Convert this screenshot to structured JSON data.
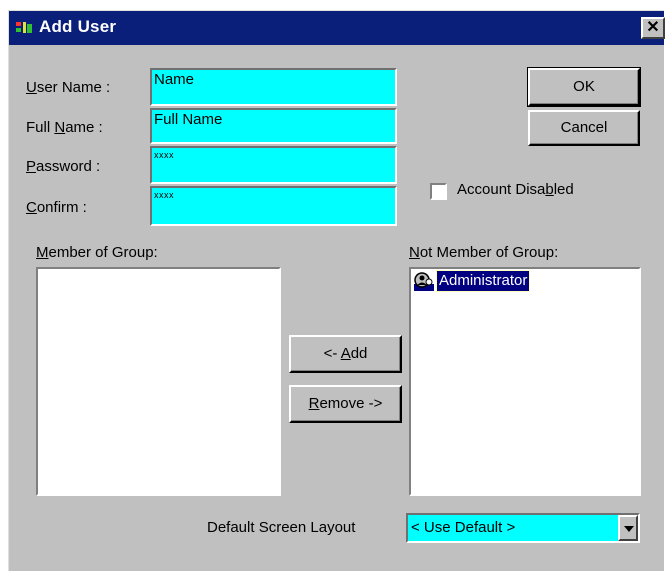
{
  "window": {
    "title": "Add User",
    "close_glyph": "✕"
  },
  "form": {
    "user_name": {
      "label_pre": "",
      "label_key": "U",
      "label_post": "ser Name :",
      "value": "Name"
    },
    "full_name": {
      "label_pre": "Full ",
      "label_key": "N",
      "label_post": "ame :",
      "value": "Full Name"
    },
    "password": {
      "label_pre": "",
      "label_key": "P",
      "label_post": "assword :",
      "value": "xxxx"
    },
    "confirm": {
      "label_pre": "",
      "label_key": "C",
      "label_post": "onfirm :",
      "value": "xxxx"
    }
  },
  "buttons": {
    "ok": "OK",
    "cancel": "Cancel",
    "add_pre": "<- ",
    "add_key": "A",
    "add_post": "dd",
    "remove_pre": "",
    "remove_key": "R",
    "remove_post": "emove ->"
  },
  "account_disabled": {
    "label_pre": "Account Disa",
    "label_key": "b",
    "label_post": "led",
    "checked": false
  },
  "member_of_group": {
    "label_pre": "",
    "label_key": "M",
    "label_post": "ember of Group:",
    "items": []
  },
  "not_member_of_group": {
    "label_pre": "",
    "label_key": "N",
    "label_post": "ot Member of Group:",
    "items": [
      {
        "label": "Administrator",
        "icon": "group-icon",
        "selected": true
      }
    ]
  },
  "default_screen_layout": {
    "label": "Default Screen Layout",
    "value": "< Use Default >"
  },
  "colors": {
    "titlebar": "#0a1f7a",
    "field_bg": "#00ffff",
    "face": "#c0c0c0",
    "selection": "#000080"
  }
}
